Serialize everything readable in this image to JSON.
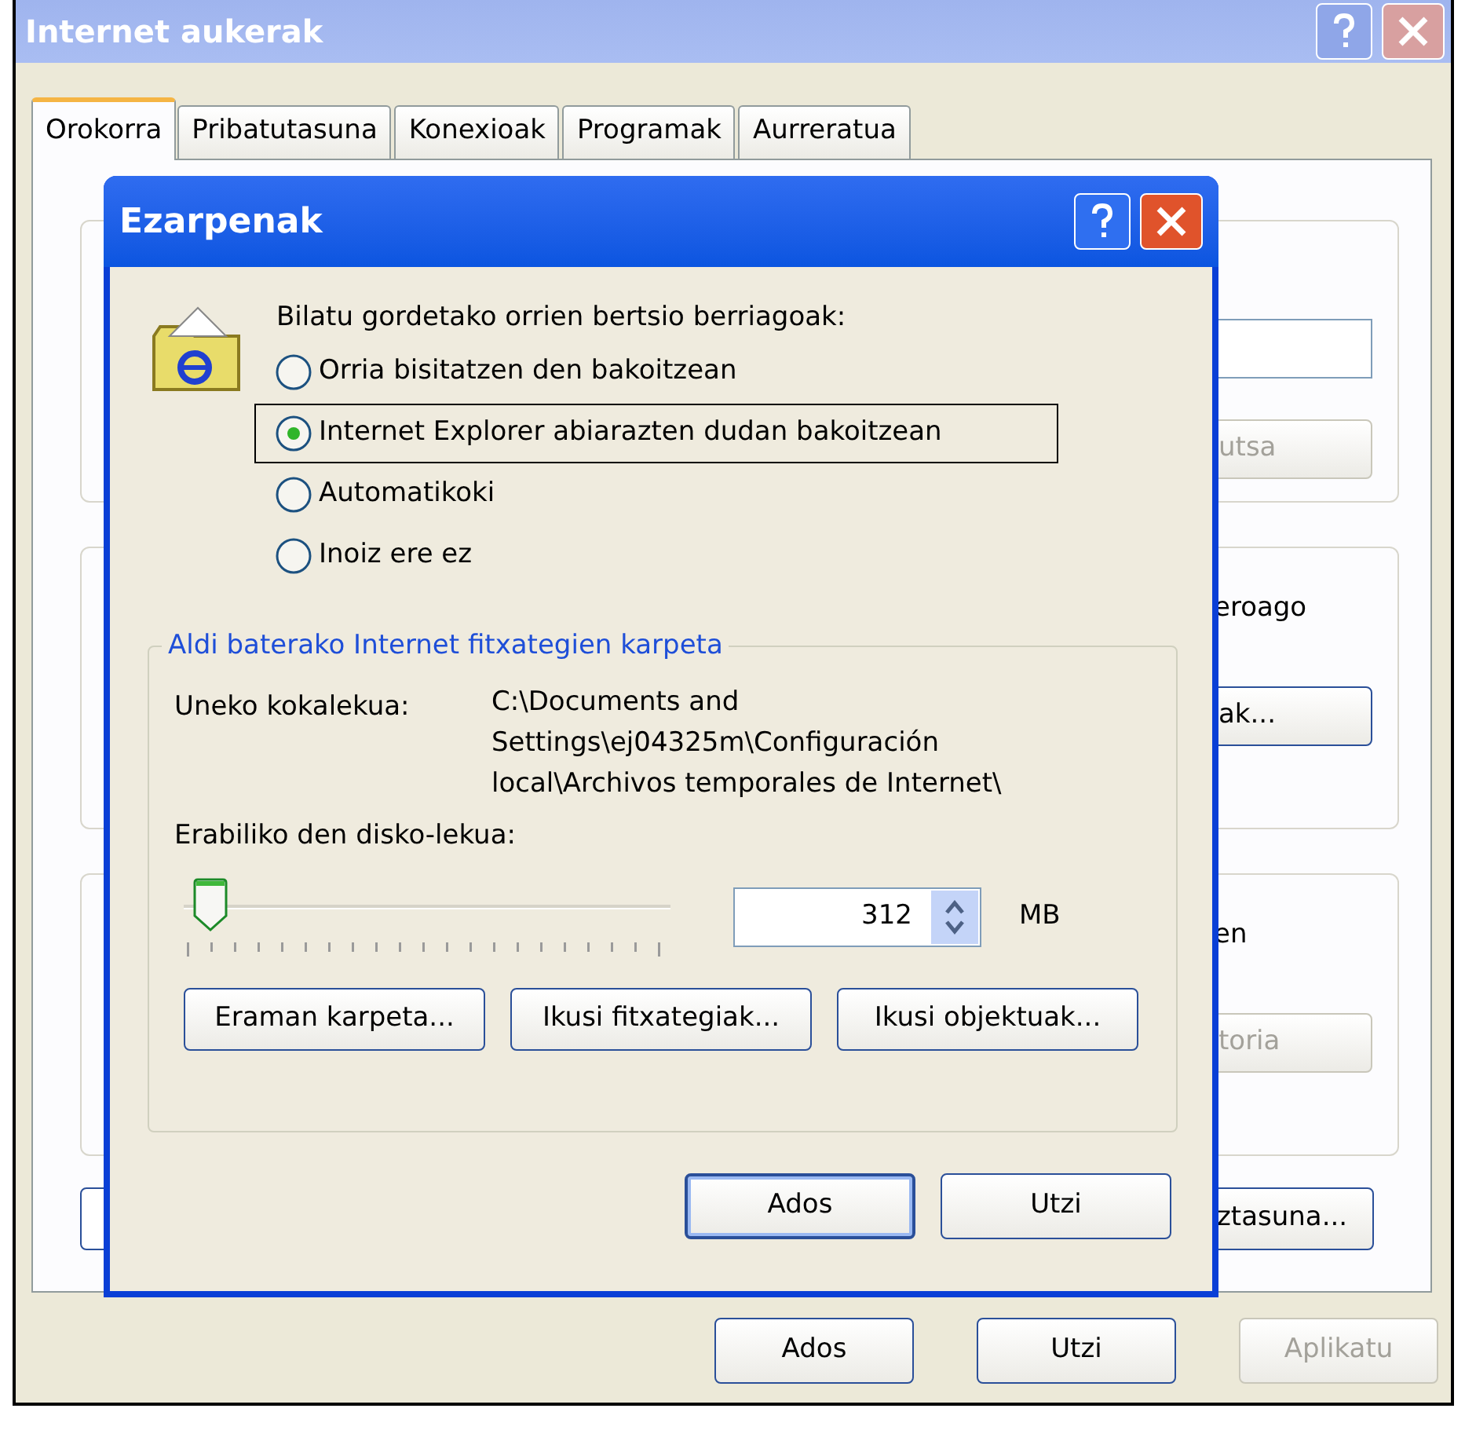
{
  "window": {
    "title": "Internet aukerak",
    "tabs": [
      {
        "label": "Orokorra",
        "selected": true
      },
      {
        "label": "Pribatutasuna",
        "selected": false
      },
      {
        "label": "Konexioak",
        "selected": false
      },
      {
        "label": "Programak",
        "selected": false
      },
      {
        "label": "Aurreratua",
        "selected": false
      }
    ],
    "groups": [
      {
        "items": [
          {
            "kind": "field"
          },
          {
            "kind": "button",
            "label": "utsa",
            "disabled": true
          }
        ]
      },
      {
        "items": [
          {
            "kind": "text",
            "label": "eroago"
          },
          {
            "kind": "button",
            "label": "ak...",
            "disabled": false
          }
        ]
      },
      {
        "items": [
          {
            "kind": "text",
            "label": "en"
          },
          {
            "kind": "button",
            "label": "toria",
            "disabled": true
          }
        ]
      }
    ],
    "bottom_button": {
      "label": "ztasuna...",
      "disabled": false
    },
    "buttons": [
      {
        "label": "Ados",
        "disabled": false
      },
      {
        "label": "Utzi",
        "disabled": false
      },
      {
        "label": "Aplikatu",
        "disabled": true
      }
    ]
  },
  "dialog": {
    "title": "Ezarpenak",
    "prompt": "Bilatu gordetako orrien bertsio berriagoak:",
    "options": [
      {
        "label": "Orria bisitatzen den bakoitzean",
        "selected": false,
        "focused": false
      },
      {
        "label": "Internet Explorer abiarazten dudan bakoitzean",
        "selected": true,
        "focused": true
      },
      {
        "label": "Automatikoki",
        "selected": false,
        "focused": false
      },
      {
        "label": "Inoiz ere ez",
        "selected": false,
        "focused": false
      }
    ],
    "group": {
      "legend": "Aldi baterako Internet fitxategien karpeta",
      "location_label": "Uneko kokalekua:",
      "location_lines": [
        "C:\\Documents and",
        "Settings\\ej04325m\\Configuración",
        "local\\Archivos temporales de Internet\\"
      ],
      "disk_label": "Erabiliko den disko-lekua:",
      "slider": {
        "level": 0.04
      },
      "size": "312",
      "unit": "MB",
      "buttons": [
        "Eraman karpeta...",
        "Ikusi fitxategiak...",
        "Ikusi objektuak..."
      ]
    },
    "buttons": [
      {
        "label": "Ados",
        "default": true
      },
      {
        "label": "Utzi",
        "default": false
      }
    ]
  }
}
